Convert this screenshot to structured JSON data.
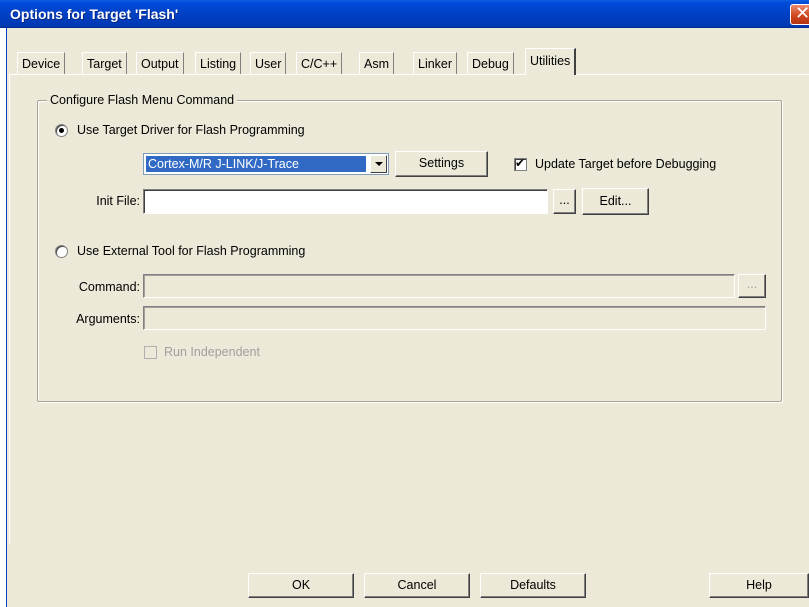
{
  "window": {
    "title": "Options for Target 'Flash'",
    "close_icon": "close-icon"
  },
  "tabs": [
    {
      "label": "Device",
      "active": false
    },
    {
      "label": "Target",
      "active": false
    },
    {
      "label": "Output",
      "active": false
    },
    {
      "label": "Listing",
      "active": false
    },
    {
      "label": "User",
      "active": false
    },
    {
      "label": "C/C++",
      "active": false
    },
    {
      "label": "Asm",
      "active": false
    },
    {
      "label": "Linker",
      "active": false
    },
    {
      "label": "Debug",
      "active": false
    },
    {
      "label": "Utilities",
      "active": true
    }
  ],
  "group": {
    "title": "Configure Flash Menu Command"
  },
  "target_driver": {
    "radio_label": "Use Target Driver for Flash Programming",
    "selected": true,
    "driver_value": "Cortex-M/R J-LINK/J-Trace",
    "settings_label": "Settings",
    "update_label": "Update Target before Debugging",
    "update_checked": true,
    "init_file_label": "Init File:",
    "init_file_value": "",
    "browse_label": "...",
    "edit_label": "Edit..."
  },
  "external_tool": {
    "radio_label": "Use External Tool for Flash Programming",
    "selected": false,
    "command_label": "Command:",
    "command_value": "",
    "browse_label": "...",
    "arguments_label": "Arguments:",
    "arguments_value": "",
    "run_independent_label": "Run Independent",
    "run_independent_checked": false
  },
  "footer": {
    "ok_label": "OK",
    "cancel_label": "Cancel",
    "defaults_label": "Defaults",
    "help_label": "Help"
  },
  "colors": {
    "titlebar": "#0040c4",
    "dialog_bg": "#ece9d8",
    "selection": "#316ac5"
  }
}
